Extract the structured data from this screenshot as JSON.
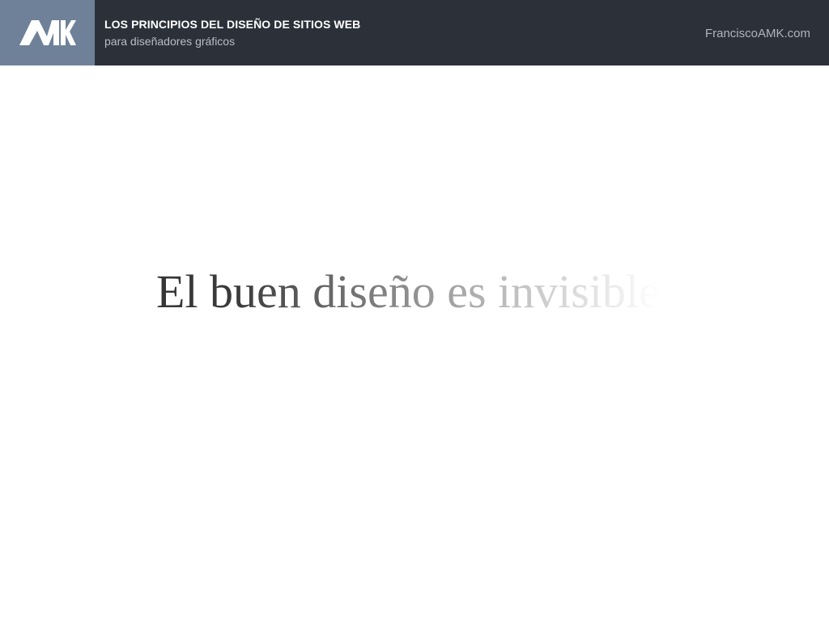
{
  "header": {
    "logo": {
      "text": "AMK",
      "icon": "amk-logo",
      "background": "#6f8198"
    },
    "title": "LOS PRINCIPIOS DEL DISEÑO DE SITIOS WEB",
    "subtitle": "para diseñadores gráficos",
    "site": "FranciscoAMK.com",
    "background": "#2c3139"
  },
  "slide": {
    "headline": "El buen diseño es invisible",
    "effect": "fade-out-right"
  }
}
